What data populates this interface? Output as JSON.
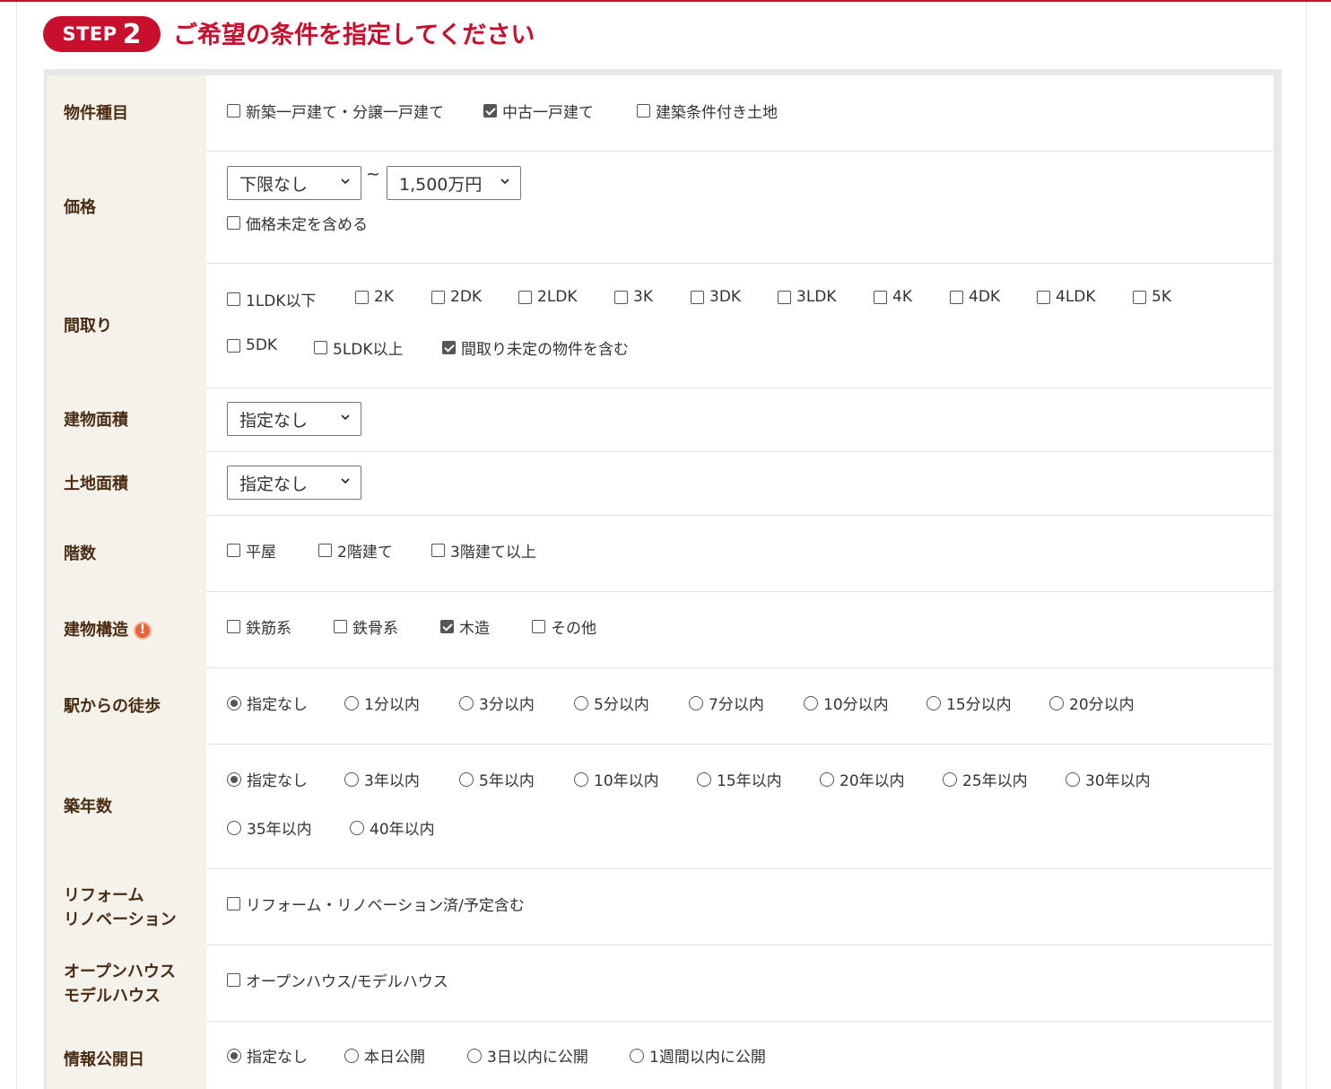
{
  "step": {
    "badge_word": "STEP",
    "badge_number": "2",
    "heading": "ご希望の条件を指定してください"
  },
  "colors": {
    "accent": "#c8102e",
    "label_bg": "#f4f2eb",
    "label_text": "#4a2c12",
    "warn": "#e8643c"
  },
  "rows": {
    "property_type": {
      "label": "物件種目",
      "options": [
        {
          "label": "新築一戸建て・分譲一戸建て",
          "checked": false
        },
        {
          "label": "中古一戸建て",
          "checked": true
        },
        {
          "label": "建築条件付き土地",
          "checked": false
        }
      ]
    },
    "price": {
      "label": "価格",
      "min_value": "下限なし",
      "separator": "~",
      "max_value": "1,500万円",
      "include_undetermined": {
        "label": "価格未定を含める",
        "checked": false
      }
    },
    "layout": {
      "label": "間取り",
      "options": [
        {
          "label": "1LDK以下",
          "checked": false
        },
        {
          "label": "2K",
          "checked": false
        },
        {
          "label": "2DK",
          "checked": false
        },
        {
          "label": "2LDK",
          "checked": false
        },
        {
          "label": "3K",
          "checked": false
        },
        {
          "label": "3DK",
          "checked": false
        },
        {
          "label": "3LDK",
          "checked": false
        },
        {
          "label": "4K",
          "checked": false
        },
        {
          "label": "4DK",
          "checked": false
        },
        {
          "label": "4LDK",
          "checked": false
        },
        {
          "label": "5K",
          "checked": false
        },
        {
          "label": "5DK",
          "checked": false
        },
        {
          "label": "5LDK以上",
          "checked": false
        },
        {
          "label": "間取り未定の物件を含む",
          "checked": true
        }
      ]
    },
    "building_area": {
      "label": "建物面積",
      "value": "指定なし"
    },
    "land_area": {
      "label": "土地面積",
      "value": "指定なし"
    },
    "floors": {
      "label": "階数",
      "options": [
        {
          "label": "平屋",
          "checked": false
        },
        {
          "label": "2階建て",
          "checked": false
        },
        {
          "label": "3階建て以上",
          "checked": false
        }
      ]
    },
    "structure": {
      "label": "建物構造",
      "info_icon": "exclamation-icon",
      "info_glyph": "!",
      "options": [
        {
          "label": "鉄筋系",
          "checked": false
        },
        {
          "label": "鉄骨系",
          "checked": false
        },
        {
          "label": "木造",
          "checked": true
        },
        {
          "label": "その他",
          "checked": false
        }
      ]
    },
    "walk": {
      "label": "駅からの徒歩",
      "options": [
        {
          "label": "指定なし",
          "selected": true
        },
        {
          "label": "1分以内",
          "selected": false
        },
        {
          "label": "3分以内",
          "selected": false
        },
        {
          "label": "5分以内",
          "selected": false
        },
        {
          "label": "7分以内",
          "selected": false
        },
        {
          "label": "10分以内",
          "selected": false
        },
        {
          "label": "15分以内",
          "selected": false
        },
        {
          "label": "20分以内",
          "selected": false
        }
      ]
    },
    "age": {
      "label": "築年数",
      "options": [
        {
          "label": "指定なし",
          "selected": true
        },
        {
          "label": "3年以内",
          "selected": false
        },
        {
          "label": "5年以内",
          "selected": false
        },
        {
          "label": "10年以内",
          "selected": false
        },
        {
          "label": "15年以内",
          "selected": false
        },
        {
          "label": "20年以内",
          "selected": false
        },
        {
          "label": "25年以内",
          "selected": false
        },
        {
          "label": "30年以内",
          "selected": false
        },
        {
          "label": "35年以内",
          "selected": false
        },
        {
          "label": "40年以内",
          "selected": false
        }
      ]
    },
    "reform": {
      "label_line1": "リフォーム",
      "label_line2": "リノベーション",
      "option": {
        "label": "リフォーム・リノベーション済/予定含む",
        "checked": false
      }
    },
    "open_house": {
      "label_line1": "オープンハウス",
      "label_line2": "モデルハウス",
      "option": {
        "label": "オープンハウス/モデルハウス",
        "checked": false
      }
    },
    "published": {
      "label": "情報公開日",
      "options": [
        {
          "label": "指定なし",
          "selected": true
        },
        {
          "label": "本日公開",
          "selected": false
        },
        {
          "label": "3日以内に公開",
          "selected": false
        },
        {
          "label": "1週間以内に公開",
          "selected": false
        }
      ]
    }
  }
}
